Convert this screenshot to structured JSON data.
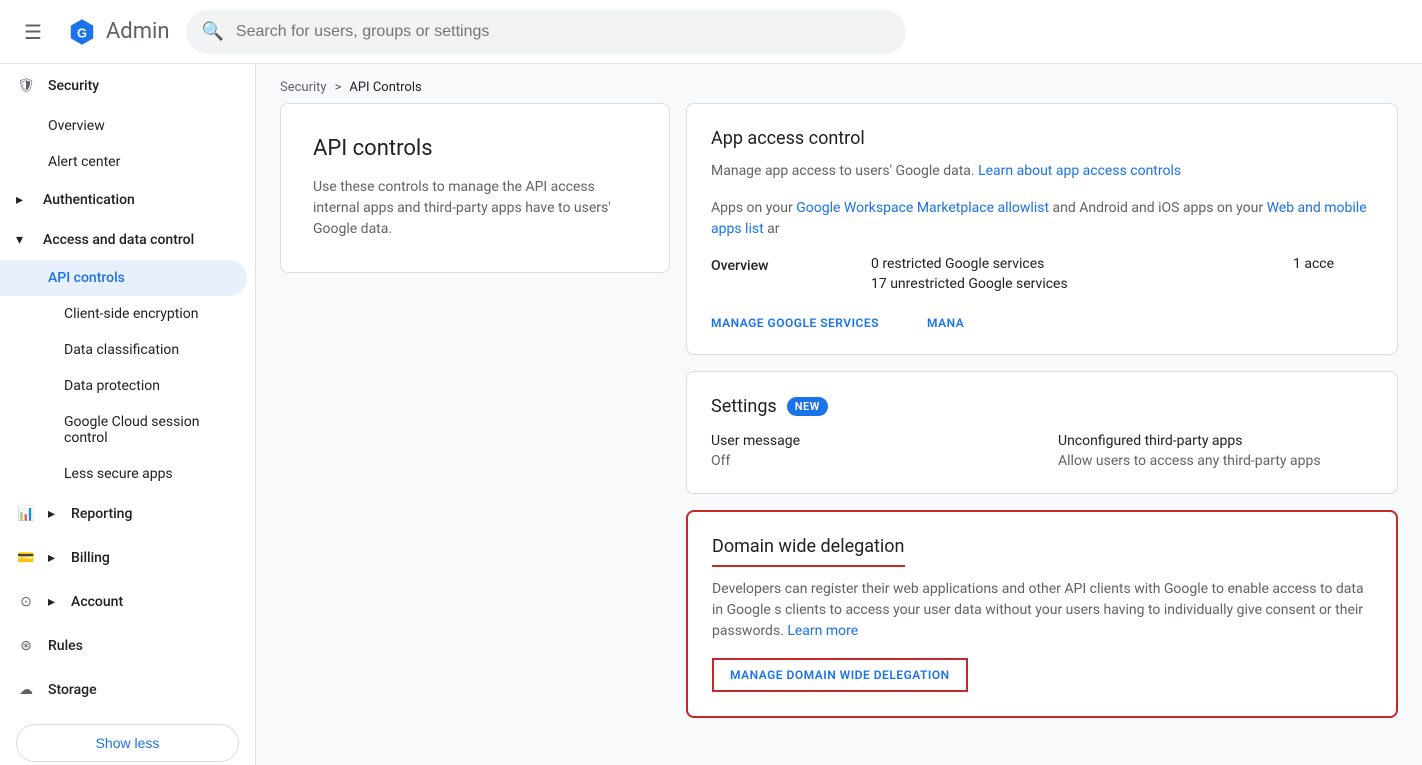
{
  "topbar": {
    "menu_icon": "☰",
    "logo_text": "Admin",
    "search_placeholder": "Search for users, groups or settings"
  },
  "sidebar": {
    "security_label": "Security",
    "overview_label": "Overview",
    "alert_center_label": "Alert center",
    "authentication_label": "Authentication",
    "access_data_control_label": "Access and data control",
    "api_controls_label": "API controls",
    "client_side_encryption_label": "Client-side encryption",
    "data_classification_label": "Data classification",
    "data_protection_label": "Data protection",
    "google_cloud_label": "Google Cloud session control",
    "less_secure_label": "Less secure apps",
    "reporting_label": "Reporting",
    "billing_label": "Billing",
    "account_label": "Account",
    "rules_label": "Rules",
    "storage_label": "Storage",
    "show_less_label": "Show less"
  },
  "breadcrumb": {
    "security": "Security",
    "separator": ">",
    "current": "API Controls"
  },
  "left_panel": {
    "title": "API controls",
    "description": "Use these controls to manage the API access internal apps and third-party apps have to users' Google data."
  },
  "app_access": {
    "title": "App access control",
    "description_prefix": "Manage app access to users' Google data.",
    "learn_link": "Learn about app access controls",
    "apps_prefix": "Apps on your",
    "marketplace_link": "Google Workspace Marketplace allowlist",
    "apps_middle": "and Android and iOS apps on your",
    "web_mobile_link": "Web and mobile apps list",
    "apps_suffix": "ar",
    "overview_label": "Overview",
    "restricted_services": "0 restricted Google services",
    "unrestricted_services": "17 unrestricted Google services",
    "access_count": "1 acce",
    "manage_google_link": "MANAGE GOOGLE SERVICES",
    "manage_other_link": "MANA"
  },
  "settings": {
    "title": "Settings",
    "new_badge": "NEW",
    "user_message_label": "User message",
    "user_message_value": "Off",
    "unconfigured_label": "Unconfigured third-party apps",
    "unconfigured_value": "Allow users to access any third-party apps"
  },
  "domain_wide": {
    "title": "Domain wide delegation",
    "description": "Developers can register their web applications and other API clients with Google to enable access to data in Google s clients to access your user data without your users having to individually give consent or their passwords.",
    "learn_more": "Learn more",
    "manage_btn": "MANAGE DOMAIN WIDE DELEGATION"
  }
}
